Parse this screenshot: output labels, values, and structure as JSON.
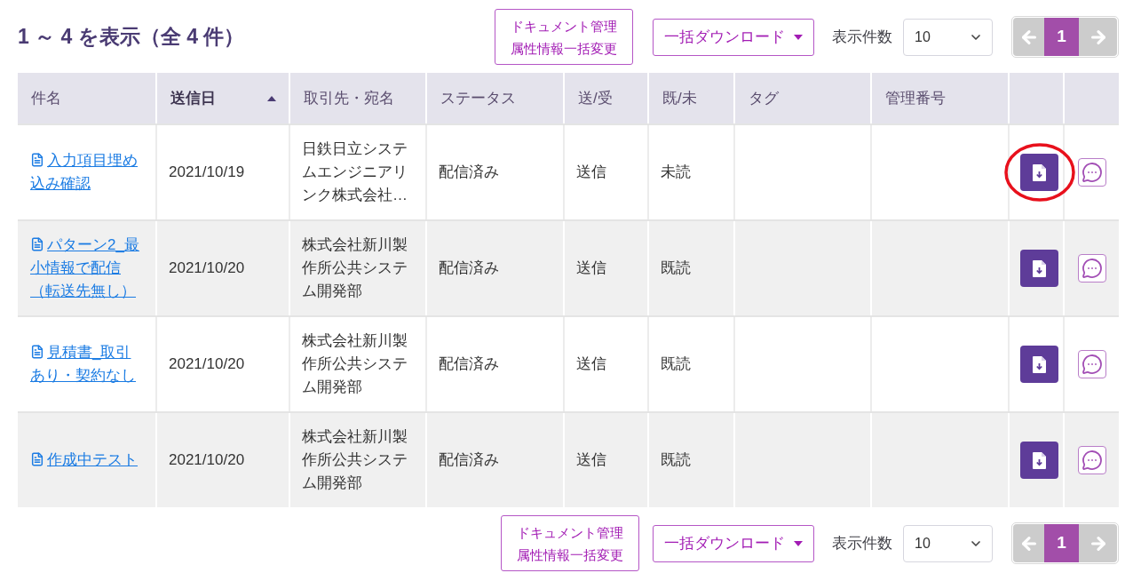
{
  "summary": "1 ～ 4 を表示（全 4 件）",
  "toolbars": [
    {
      "bulk_edit_lines": [
        "ドキュメント管理",
        "属性情報一括変更"
      ],
      "download_menu": "一括ダウンロード",
      "page_size_label": "表示件数",
      "page_size": "10",
      "pagination": {
        "previous_disabled": true,
        "next_disabled": true,
        "pages": [
          {
            "label": "1",
            "selected": true
          }
        ]
      }
    },
    {
      "bulk_edit_lines": [
        "ドキュメント管理",
        "属性情報一括変更"
      ],
      "download_menu": "一括ダウンロード",
      "page_size_label": "表示件数",
      "page_size": "10",
      "pagination": {
        "previous_disabled": true,
        "next_disabled": true,
        "pages": [
          {
            "label": "1",
            "selected": true
          }
        ]
      }
    }
  ],
  "table": {
    "columns": [
      {
        "label": "件名",
        "sorted": false
      },
      {
        "label": "送信日",
        "sorted": true
      },
      {
        "label": "取引先・宛名",
        "sorted": false
      },
      {
        "label": "ステータス",
        "sorted": false
      },
      {
        "label": "送/受",
        "sorted": false
      },
      {
        "label": "既/未",
        "sorted": false
      },
      {
        "label": "タグ",
        "sorted": false
      },
      {
        "label": "管理番号",
        "sorted": false
      }
    ],
    "rows": [
      {
        "subject": "入力項目埋め込み確認",
        "sent_date": "2021/10/19",
        "recipient": "日鉄日立システムエンジニアリンク株式会社…",
        "status": "配信済み",
        "direction": "送信",
        "read_state": "未読",
        "highlighted": true
      },
      {
        "subject": "パターン2_最小情報で配信（転送先無し）",
        "sent_date": "2021/10/20",
        "recipient": "株式会社新川製作所公共システム開発部",
        "status": "配信済み",
        "direction": "送信",
        "read_state": "既読",
        "highlighted": false
      },
      {
        "subject": "見積書_取引あり・契約なし",
        "sent_date": "2021/10/20",
        "recipient": "株式会社新川製作所公共システム開発部",
        "status": "配信済み",
        "direction": "送信",
        "read_state": "既読",
        "highlighted": false
      },
      {
        "subject": "作成中テスト",
        "sent_date": "2021/10/20",
        "recipient": "株式会社新川製作所公共システム開発部",
        "status": "配信済み",
        "direction": "送信",
        "read_state": "既読",
        "highlighted": false
      }
    ]
  }
}
